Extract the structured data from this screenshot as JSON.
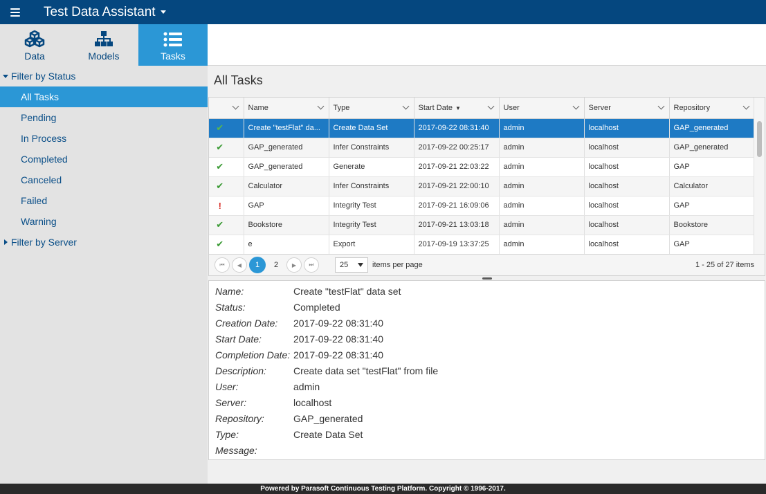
{
  "header": {
    "title": "Test Data Assistant"
  },
  "navtabs": [
    {
      "label": "Data",
      "icon": "cubes-icon"
    },
    {
      "label": "Models",
      "icon": "sitemap-icon"
    },
    {
      "label": "Tasks",
      "icon": "list-icon",
      "active": true
    }
  ],
  "sidebar": {
    "status_filter_label": "Filter by Status",
    "status_items": [
      "All Tasks",
      "Pending",
      "In Process",
      "Completed",
      "Canceled",
      "Failed",
      "Warning"
    ],
    "server_filter_label": "Filter by Server"
  },
  "main": {
    "title": "All Tasks"
  },
  "grid": {
    "columns": [
      "",
      "Name",
      "Type",
      "Start Date",
      "User",
      "Server",
      "Repository"
    ],
    "sort_indicator": "▼",
    "rows": [
      {
        "status": "✔",
        "name": "Create \"testFlat\" da...",
        "type": "Create Data Set",
        "start": "2017-09-22 08:31:40",
        "user": "admin",
        "server": "localhost",
        "repo": "GAP_generated"
      },
      {
        "status": "✔",
        "name": "GAP_generated",
        "type": "Infer Constraints",
        "start": "2017-09-22 00:25:17",
        "user": "admin",
        "server": "localhost",
        "repo": "GAP_generated"
      },
      {
        "status": "✔",
        "name": "GAP_generated",
        "type": "Generate",
        "start": "2017-09-21 22:03:22",
        "user": "admin",
        "server": "localhost",
        "repo": "GAP"
      },
      {
        "status": "✔",
        "name": "Calculator",
        "type": "Infer Constraints",
        "start": "2017-09-21 22:00:10",
        "user": "admin",
        "server": "localhost",
        "repo": "Calculator"
      },
      {
        "status": "!",
        "name": "GAP",
        "type": "Integrity Test",
        "start": "2017-09-21 16:09:06",
        "user": "admin",
        "server": "localhost",
        "repo": "GAP"
      },
      {
        "status": "✔",
        "name": "Bookstore",
        "type": "Integrity Test",
        "start": "2017-09-21 13:03:18",
        "user": "admin",
        "server": "localhost",
        "repo": "Bookstore"
      },
      {
        "status": "✔",
        "name": "e",
        "type": "Export",
        "start": "2017-09-19 13:37:25",
        "user": "admin",
        "server": "localhost",
        "repo": "GAP"
      }
    ]
  },
  "pager": {
    "first": "⏮",
    "prev": "◀",
    "next": "▶",
    "last": "⏭",
    "pages": [
      "1",
      "2"
    ],
    "page_size": "25",
    "page_size_label": "items per page",
    "info": "1 - 25 of 27 items"
  },
  "details": [
    {
      "label": "Name:",
      "value": "Create \"testFlat\" data set"
    },
    {
      "label": "Status:",
      "value": "Completed"
    },
    {
      "label": "Creation Date:",
      "value": "2017-09-22 08:31:40"
    },
    {
      "label": "Start Date:",
      "value": "2017-09-22 08:31:40"
    },
    {
      "label": "Completion Date:",
      "value": "2017-09-22 08:31:40"
    },
    {
      "label": "Description:",
      "value": "Create data set \"testFlat\" from file"
    },
    {
      "label": "User:",
      "value": "admin"
    },
    {
      "label": "Server:",
      "value": "localhost"
    },
    {
      "label": "Repository:",
      "value": "GAP_generated"
    },
    {
      "label": "Type:",
      "value": "Create Data Set"
    },
    {
      "label": "Message:",
      "value": ""
    }
  ],
  "footer": {
    "text": "Powered by Parasoft Continuous Testing Platform. Copyright © 1996-2017."
  },
  "colors": {
    "header": "#05477f",
    "accent": "#2b97d6",
    "selected_row": "#1e7ac4",
    "ok": "#3a9a34",
    "error": "#d9312b"
  }
}
